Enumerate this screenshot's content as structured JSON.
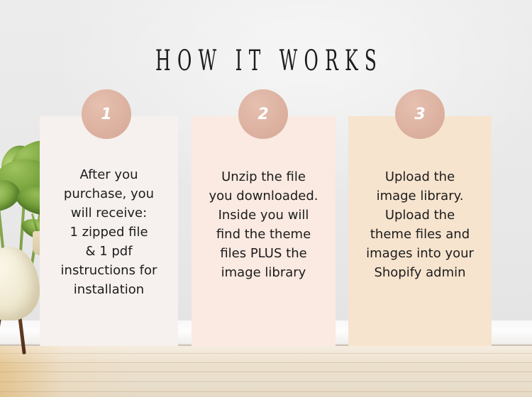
{
  "page": {
    "title": "HOW IT WORKS",
    "background_wall_color": "#e9e9e9",
    "floor_color": "#ecdfcc",
    "badge_color": "#ddb2a1"
  },
  "decor": {
    "plant_label": "monstera-plant",
    "pot_label": "planter-pot",
    "floor_label": "wood-floor",
    "baseboard_label": "wall-baseboard"
  },
  "steps": [
    {
      "number": "1",
      "text": "After you\npurchase, you\nwill receive:\n1 zipped file\n& 1 pdf\ninstructions for\ninstallation",
      "card_color": "#f6f1ee"
    },
    {
      "number": "2",
      "text": "Unzip the file\nyou downloaded.\nInside you will\nfind the theme\nfiles PLUS the\nimage library",
      "card_color": "#faeae1"
    },
    {
      "number": "3",
      "text": "Upload the\nimage library.\nUpload the\ntheme files and\nimages into your\nShopify admin",
      "card_color": "#f7e4ce"
    }
  ]
}
